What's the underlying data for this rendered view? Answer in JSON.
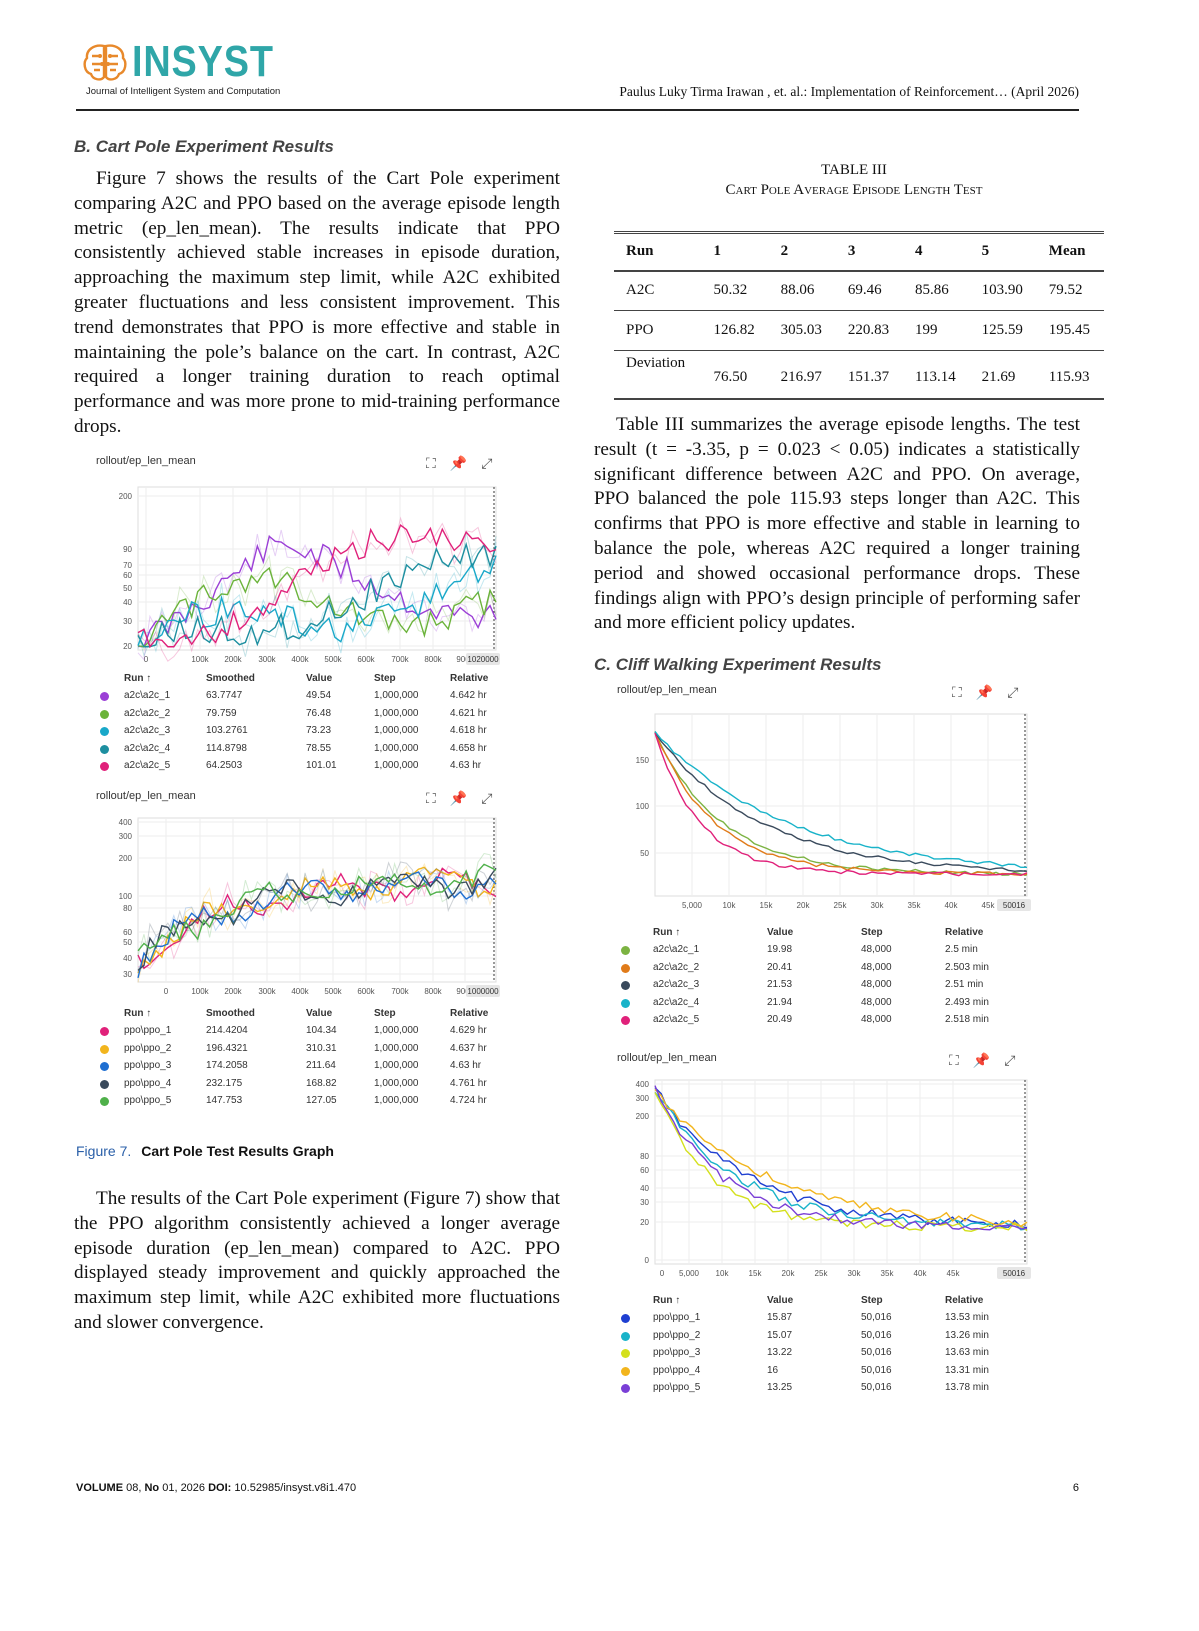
{
  "header": {
    "logo_word": "INSYST",
    "logo_sub": "Journal of Intelligent System and Computation",
    "running_head": "Paulus Luky Tirma Irawan , et. al.: Implementation of Reinforcement… (April 2026)"
  },
  "sections": {
    "b_title": "B. Cart Pole Experiment Results",
    "b_para1": "Figure 7 shows the results of the Cart Pole experiment comparing A2C and PPO based on the average episode length metric (ep_len_mean). The results indicate that PPO consistently achieved stable increases in episode duration, approaching the maximum step limit, while A2C exhibited greater fluctuations and less consistent improvement. This trend demonstrates that PPO is more effective and stable in maintaining the pole’s balance on the cart. In contrast, A2C required a longer training duration to reach optimal performance and was more prone to mid-training performance drops.",
    "b_para2": "The results of the Cart Pole experiment (Figure 7) show that the PPO algorithm consistently achieved a longer average episode duration (ep_len_mean) compared to A2C. PPO displayed steady improvement and quickly approached the maximum step limit, while A2C exhibited more fluctuations and slower convergence.",
    "table_para": "Table III summarizes the average episode lengths. The test result (t = -3.35, p = 0.023 < 0.05) indicates a statistically significant difference between A2C and PPO. On average, PPO balanced the pole 115.93 steps longer than A2C. This confirms that PPO is more effective and stable in learning to balance the pole, whereas A2C required a longer training period and showed occasional performance drops. These findings align with PPO’s design principle of performing safer and more efficient policy updates.",
    "c_title": "C. Cliff Walking Experiment Results"
  },
  "table3": {
    "label": "TABLE III",
    "caption": "Cart Pole Average Episode Length Test",
    "headers": [
      "Run",
      "1",
      "2",
      "3",
      "4",
      "5",
      "Mean"
    ],
    "rows": [
      [
        "A2C",
        "50.32",
        "88.06",
        "69.46",
        "85.86",
        "103.90",
        "79.52"
      ],
      [
        "PPO",
        "126.82",
        "305.03",
        "220.83",
        "199",
        "125.59",
        "195.45"
      ],
      [
        "Deviation",
        "76.50",
        "216.97",
        "151.37",
        "113.14",
        "21.69",
        "115.93"
      ]
    ]
  },
  "figure": {
    "number": "Figure 7.",
    "caption": "Cart Pole Test Results Graph"
  },
  "panels": [
    {
      "title": "rollout/ep_len_mean",
      "icons": [
        "fit-icon",
        "pin-icon",
        "fullscreen-icon"
      ],
      "y_ticks": [
        "200",
        "90",
        "70",
        "60",
        "50",
        "40",
        "30",
        "20"
      ],
      "x_ticks": [
        "0",
        "100k",
        "200k",
        "300k",
        "400k",
        "500k",
        "600k",
        "700k",
        "800k",
        "900k"
      ],
      "x_end": "1020000",
      "columns": [
        "Run ↑",
        "Smoothed",
        "Value",
        "Step",
        "Relative"
      ],
      "rows": [
        [
          "a2c\\a2c_1",
          "63.7747",
          "49.54",
          "1,000,000",
          "4.642 hr"
        ],
        [
          "a2c\\a2c_2",
          "79.759",
          "76.48",
          "1,000,000",
          "4.621 hr"
        ],
        [
          "a2c\\a2c_3",
          "103.2761",
          "73.23",
          "1,000,000",
          "4.618 hr"
        ],
        [
          "a2c\\a2c_4",
          "114.8798",
          "78.55",
          "1,000,000",
          "4.658 hr"
        ],
        [
          "a2c\\a2c_5",
          "64.2503",
          "101.01",
          "1,000,000",
          "4.63 hr"
        ]
      ],
      "colors": [
        "#9b3fd6",
        "#6bb33a",
        "#19a8c9",
        "#1d8fa0",
        "#e0217a"
      ]
    },
    {
      "title": "rollout/ep_len_mean",
      "icons": [
        "fit-icon",
        "pin-icon",
        "fullscreen-icon"
      ],
      "y_ticks": [
        "400",
        "300",
        "200",
        "100",
        "80",
        "60",
        "50",
        "40",
        "30"
      ],
      "x_ticks": [
        "0",
        "100k",
        "200k",
        "300k",
        "400k",
        "500k",
        "600k",
        "700k",
        "800k",
        "900k"
      ],
      "x_end": "1000000",
      "columns": [
        "Run ↑",
        "Smoothed",
        "Value",
        "Step",
        "Relative"
      ],
      "rows": [
        [
          "ppo\\ppo_1",
          "214.4204",
          "104.34",
          "1,000,000",
          "4.629 hr"
        ],
        [
          "ppo\\ppo_2",
          "196.4321",
          "310.31",
          "1,000,000",
          "4.637 hr"
        ],
        [
          "ppo\\ppo_3",
          "174.2058",
          "211.64",
          "1,000,000",
          "4.63 hr"
        ],
        [
          "ppo\\ppo_4",
          "232.175",
          "168.82",
          "1,000,000",
          "4.761 hr"
        ],
        [
          "ppo\\ppo_5",
          "147.753",
          "127.05",
          "1,000,000",
          "4.724 hr"
        ]
      ],
      "colors": [
        "#e0217a",
        "#f2b51d",
        "#1f6fd1",
        "#3a4a5c",
        "#4fb04a"
      ]
    },
    {
      "title": "rollout/ep_len_mean",
      "icons": [
        "fit-icon",
        "pin-icon",
        "fullscreen-icon"
      ],
      "y_ticks": [
        "150",
        "100",
        "50"
      ],
      "x_ticks": [
        "5,000",
        "10k",
        "15k",
        "20k",
        "25k",
        "30k",
        "35k",
        "40k",
        "45k"
      ],
      "x_end": "50016",
      "columns": [
        "Run ↑",
        "Value",
        "Step",
        "Relative"
      ],
      "rows": [
        [
          "a2c\\a2c_1",
          "19.98",
          "48,000",
          "2.5 min"
        ],
        [
          "a2c\\a2c_2",
          "20.41",
          "48,000",
          "2.503 min"
        ],
        [
          "a2c\\a2c_3",
          "21.53",
          "48,000",
          "2.51 min"
        ],
        [
          "a2c\\a2c_4",
          "21.94",
          "48,000",
          "2.493 min"
        ],
        [
          "a2c\\a2c_5",
          "20.49",
          "48,000",
          "2.518 min"
        ]
      ],
      "colors": [
        "#7cb342",
        "#e07b1a",
        "#3a4a5c",
        "#19b3c9",
        "#e0217a"
      ]
    },
    {
      "title": "rollout/ep_len_mean",
      "icons": [
        "fit-icon",
        "pin-icon",
        "fullscreen-icon"
      ],
      "y_ticks": [
        "400",
        "300",
        "200",
        "80",
        "60",
        "40",
        "30",
        "20",
        "0"
      ],
      "x_ticks": [
        "0",
        "5,000",
        "10k",
        "15k",
        "20k",
        "25k",
        "30k",
        "35k",
        "40k",
        "45k"
      ],
      "x_end": "50016",
      "columns": [
        "Run ↑",
        "Value",
        "Step",
        "Relative"
      ],
      "rows": [
        [
          "ppo\\ppo_1",
          "15.87",
          "50,016",
          "13.53 min"
        ],
        [
          "ppo\\ppo_2",
          "15.07",
          "50,016",
          "13.26 min"
        ],
        [
          "ppo\\ppo_3",
          "13.22",
          "50,016",
          "13.63 min"
        ],
        [
          "ppo\\ppo_4",
          "16",
          "50,016",
          "13.31 min"
        ],
        [
          "ppo\\ppo_5",
          "13.25",
          "50,016",
          "13.78 min"
        ]
      ],
      "colors": [
        "#1f3fd1",
        "#19b3c9",
        "#d4e01d",
        "#f2b51d",
        "#7a3fd6"
      ]
    }
  ],
  "footer": {
    "volume_label": "VOLUME",
    "volume": "08,",
    "no_label": "No",
    "no": "01, 2026",
    "doi_label": "DOI:",
    "doi": "10.52985/insyst.v8i1.470",
    "page": "6"
  }
}
